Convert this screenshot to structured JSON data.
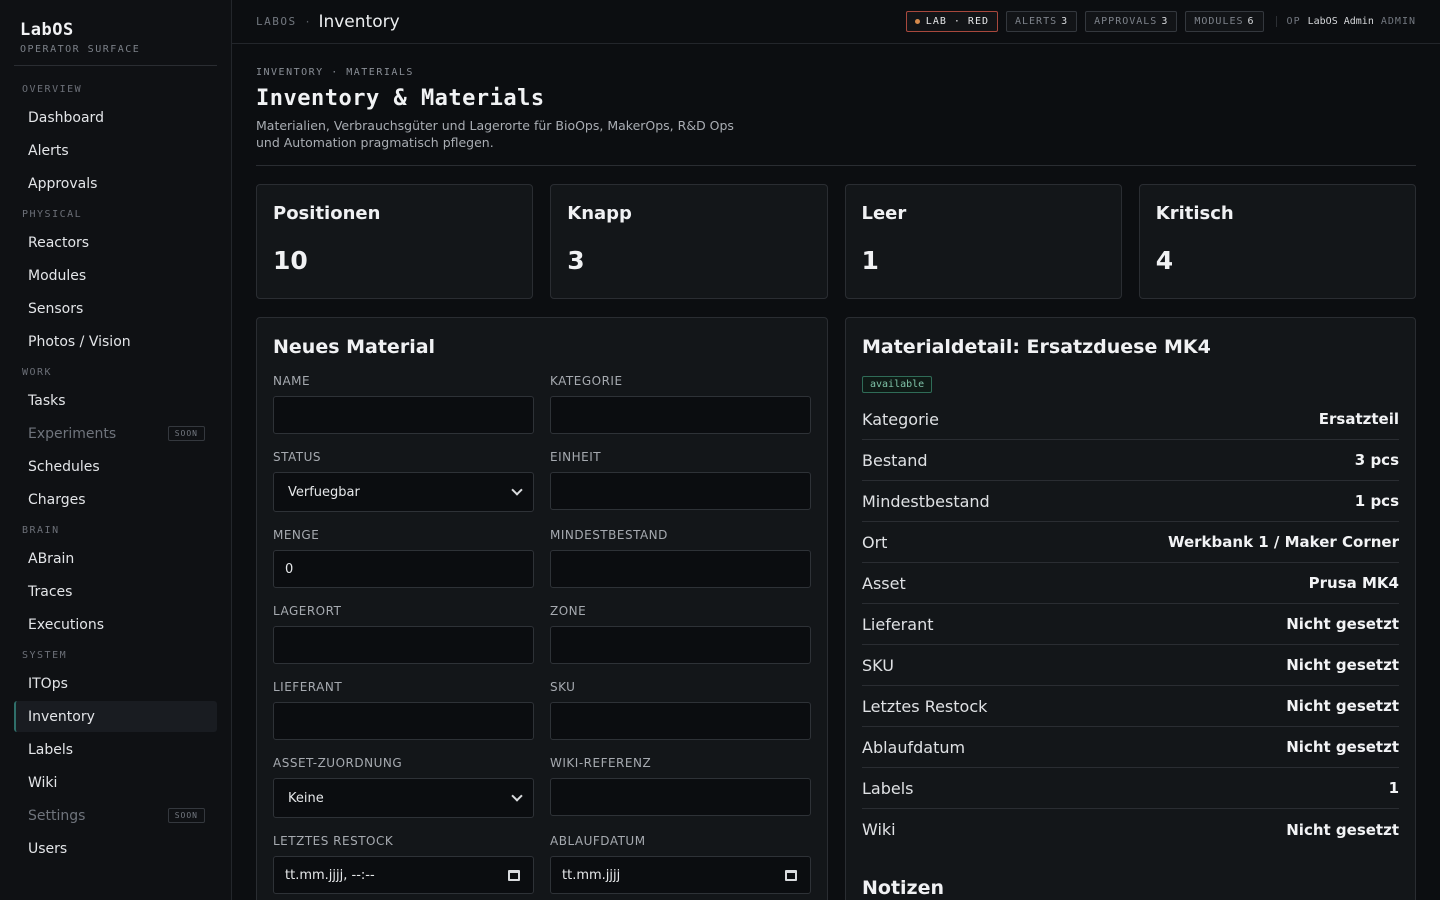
{
  "brand": {
    "title": "LabOS",
    "subtitle": "OPERATOR SURFACE"
  },
  "nav": {
    "sections": [
      {
        "label": "OVERVIEW",
        "items": [
          {
            "label": "Dashboard"
          },
          {
            "label": "Alerts"
          },
          {
            "label": "Approvals"
          }
        ]
      },
      {
        "label": "PHYSICAL",
        "items": [
          {
            "label": "Reactors"
          },
          {
            "label": "Modules"
          },
          {
            "label": "Sensors"
          },
          {
            "label": "Photos / Vision"
          }
        ]
      },
      {
        "label": "WORK",
        "items": [
          {
            "label": "Tasks"
          },
          {
            "label": "Experiments",
            "badge": "SOON"
          },
          {
            "label": "Schedules"
          },
          {
            "label": "Charges"
          }
        ]
      },
      {
        "label": "BRAIN",
        "items": [
          {
            "label": "ABrain"
          },
          {
            "label": "Traces"
          },
          {
            "label": "Executions"
          }
        ]
      },
      {
        "label": "SYSTEM",
        "items": [
          {
            "label": "ITOps"
          },
          {
            "label": "Inventory"
          },
          {
            "label": "Labels"
          },
          {
            "label": "Wiki"
          },
          {
            "label": "Settings",
            "badge": "SOON"
          },
          {
            "label": "Users"
          }
        ]
      }
    ]
  },
  "topbar": {
    "root": "LABOS",
    "sep": "·",
    "page": "Inventory",
    "lab_label": "LAB · RED",
    "alerts_label": "ALERTS",
    "alerts_count": "3",
    "approvals_label": "APPROVALS",
    "approvals_count": "3",
    "modules_label": "MODULES",
    "modules_count": "6",
    "op_prefix": "OP",
    "op_name": "LabOS Admin",
    "op_role": "ADMIN"
  },
  "header": {
    "eyebrow": "INVENTORY · MATERIALS",
    "title": "Inventory & Materials",
    "description": "Materialien, Verbrauchsgüter und Lagerorte für BioOps, MakerOps, R&D Ops und Automation pragmatisch pflegen."
  },
  "stats": [
    {
      "label": "Positionen",
      "value": "10"
    },
    {
      "label": "Knapp",
      "value": "3"
    },
    {
      "label": "Leer",
      "value": "1"
    },
    {
      "label": "Kritisch",
      "value": "4"
    }
  ],
  "form": {
    "title": "Neues Material",
    "fields": {
      "name": {
        "label": "NAME",
        "value": ""
      },
      "category": {
        "label": "KATEGORIE",
        "value": ""
      },
      "status": {
        "label": "STATUS",
        "value": "Verfuegbar"
      },
      "unit": {
        "label": "EINHEIT",
        "value": ""
      },
      "quantity": {
        "label": "MENGE",
        "value": "0"
      },
      "min_stock": {
        "label": "MINDESTBESTAND",
        "value": ""
      },
      "location": {
        "label": "LAGERORT",
        "value": ""
      },
      "zone": {
        "label": "ZONE",
        "value": ""
      },
      "supplier": {
        "label": "LIEFERANT",
        "value": ""
      },
      "sku": {
        "label": "SKU",
        "value": ""
      },
      "asset": {
        "label": "ASSET-ZUORDNUNG",
        "value": "Keine"
      },
      "wiki": {
        "label": "WIKI-REFERENZ",
        "value": ""
      },
      "restock": {
        "label": "LETZTES RESTOCK",
        "value": "tt.mm.jjjj, --:--"
      },
      "expiry": {
        "label": "ABLAUFDATUM",
        "value": "tt.mm.jjjj"
      }
    }
  },
  "detail": {
    "title": "Materialdetail: Ersatzduese MK4",
    "status_badge": "available",
    "rows": [
      {
        "key": "Kategorie",
        "value": "Ersatzteil"
      },
      {
        "key": "Bestand",
        "value": "3 pcs"
      },
      {
        "key": "Mindestbestand",
        "value": "1 pcs"
      },
      {
        "key": "Ort",
        "value": "Werkbank 1 / Maker Corner"
      },
      {
        "key": "Asset",
        "value": "Prusa MK4"
      },
      {
        "key": "Lieferant",
        "value": "Nicht gesetzt"
      },
      {
        "key": "SKU",
        "value": "Nicht gesetzt"
      },
      {
        "key": "Letztes Restock",
        "value": "Nicht gesetzt"
      },
      {
        "key": "Ablaufdatum",
        "value": "Nicht gesetzt"
      },
      {
        "key": "Labels",
        "value": "1"
      },
      {
        "key": "Wiki",
        "value": "Nicht gesetzt"
      }
    ],
    "notes_title": "Notizen"
  }
}
